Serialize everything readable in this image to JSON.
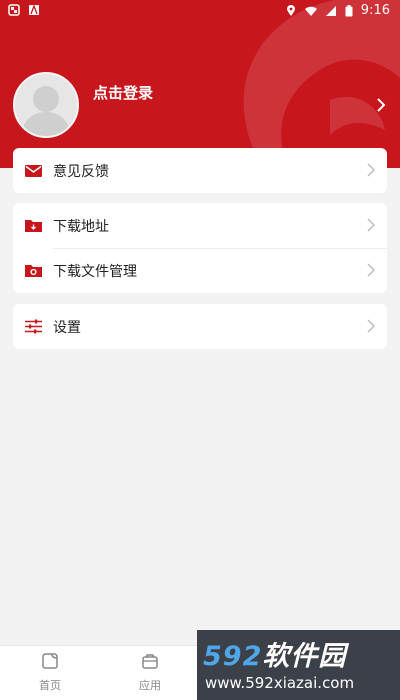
{
  "status_bar": {
    "time": "9:16",
    "left_icons": [
      "app-icon",
      "font-icon"
    ],
    "right_icons": [
      "location-icon",
      "wifi-icon",
      "signal-icon",
      "battery-icon"
    ]
  },
  "header": {
    "login_label": "点击登录",
    "background": "#c8161d"
  },
  "menu": {
    "feedback": "意见反馈",
    "download_address": "下载地址",
    "download_manager": "下载文件管理",
    "settings": "设置"
  },
  "tabs": [
    {
      "label": "首页",
      "icon": "home-icon"
    },
    {
      "label": "应用",
      "icon": "app-bag-icon"
    }
  ],
  "watermark": {
    "logo_num": "592",
    "logo_text": "软件园",
    "url": "www.592xiazai.com"
  },
  "colors": {
    "accent": "#c8161d",
    "text": "#222222",
    "muted": "#888888"
  }
}
